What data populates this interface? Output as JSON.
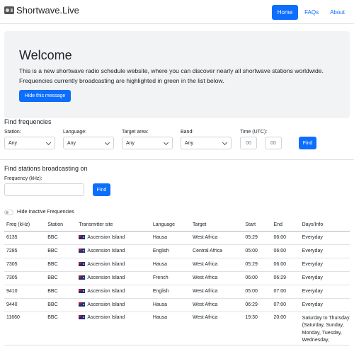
{
  "navbar": {
    "brand": "Shortwave.Live",
    "brand_icon": "radio-icon",
    "links": [
      "Home",
      "FAQs",
      "About"
    ]
  },
  "welcome": {
    "title": "Welcome",
    "text": "This is a new shortwave radio schedule website, where you can discover nearly all shortwave stations worldwide. Frequencies currently broadcasting are highlighted in green in the list below.",
    "button": "Hide this message"
  },
  "find_frequencies": {
    "title": "Find frequencies",
    "station_label": "Station:",
    "station_value": "Any",
    "language_label": "Language:",
    "language_value": "Any",
    "target_label": "Target area:",
    "target_value": "Any",
    "band_label": "Band:",
    "band_value": "Any",
    "time_label": "Time (UTC):",
    "time_hours_placeholder": "00",
    "time_minutes_placeholder": "00",
    "find_button": "Find"
  },
  "find_stations": {
    "title": "Find stations broadcasting on",
    "frequency_label": "Frequency (kHz):",
    "frequency_value": "",
    "find_button": "Find"
  },
  "toggle": {
    "label": "Hide Inactive Frequencies",
    "checked": false
  },
  "table": {
    "headers": [
      "Freq (kHz)",
      "Station",
      "Transmitter site",
      "Language",
      "Target",
      "Start",
      "End",
      "Days/Info"
    ],
    "rows": [
      {
        "freq": "6135",
        "station": "BBC",
        "site": "Ascension Island",
        "language": "Hausa",
        "target": "West Africa",
        "start": "05:29",
        "end": "06:00",
        "days": "Everyday"
      },
      {
        "freq": "7285",
        "station": "BBC",
        "site": "Ascension Island",
        "language": "English",
        "target": "Central Africa",
        "start": "05:00",
        "end": "06:00",
        "days": "Everyday"
      },
      {
        "freq": "7305",
        "station": "BBC",
        "site": "Ascension Island",
        "language": "Hausa",
        "target": "West Africa",
        "start": "05:29",
        "end": "06:00",
        "days": "Everyday"
      },
      {
        "freq": "7305",
        "station": "BBC",
        "site": "Ascension Island",
        "language": "French",
        "target": "West Africa",
        "start": "06:00",
        "end": "06:29",
        "days": "Everyday"
      },
      {
        "freq": "9410",
        "station": "BBC",
        "site": "Ascension Island",
        "language": "English",
        "target": "West Africa",
        "start": "05:00",
        "end": "07:00",
        "days": "Everyday"
      },
      {
        "freq": "9440",
        "station": "BBC",
        "site": "Ascension Island",
        "language": "Hausa",
        "target": "West Africa",
        "start": "06:29",
        "end": "07:00",
        "days": "Everyday"
      },
      {
        "freq": "11660",
        "station": "BBC",
        "site": "Ascension Island",
        "language": "Hausa",
        "target": "West Africa",
        "start": "19:30",
        "end": "20:00",
        "days": "Saturday to Thursday (Saturday, Sunday, Monday, Tuesday, Wednesday,"
      }
    ]
  }
}
